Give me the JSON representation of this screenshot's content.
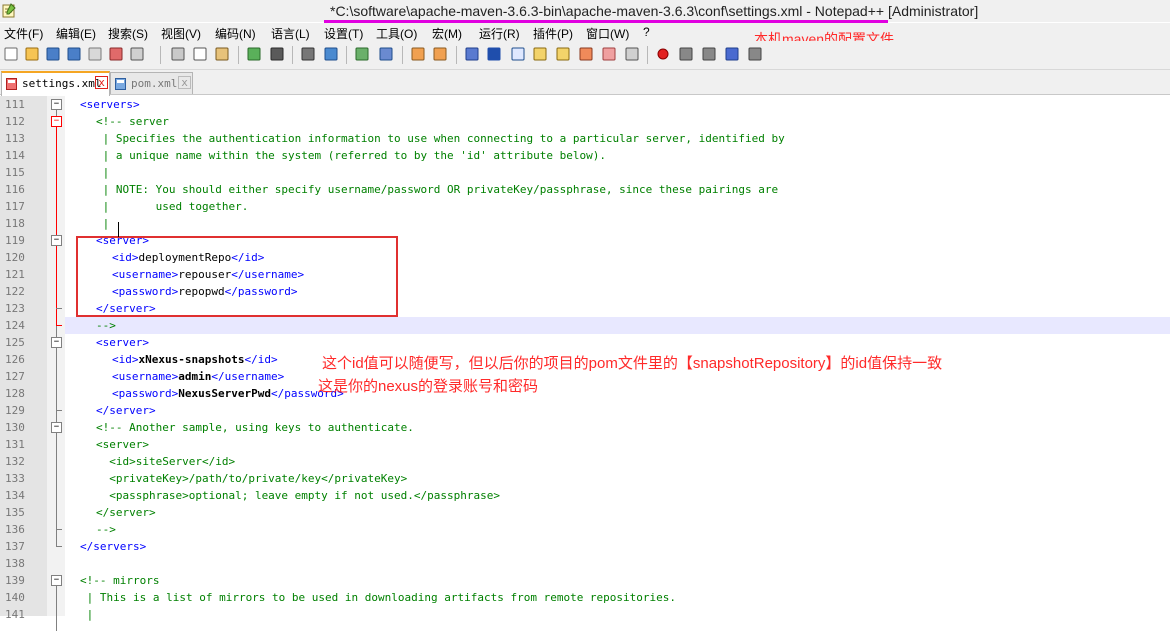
{
  "window": {
    "title": "*C:\\software\\apache-maven-3.6.3-bin\\apache-maven-3.6.3\\conf\\settings.xml - Notepad++ [Administrator]",
    "icon": "notepad-plus-plus-icon"
  },
  "menu": [
    "文件(F)",
    "编辑(E)",
    "搜索(S)",
    "视图(V)",
    "编码(N)",
    "语言(L)",
    "设置(T)",
    "工具(O)",
    "宏(M)",
    "运行(R)",
    "插件(P)",
    "窗口(W)",
    "?"
  ],
  "annotation_top": "本机maven的配置文件",
  "tabs": [
    {
      "label": "settings.xml",
      "active": true,
      "close": "x"
    },
    {
      "label": "pom.xml",
      "active": false,
      "close": "x"
    }
  ],
  "editor": {
    "current_line": 124,
    "lines": [
      {
        "n": "111",
        "parts": [
          [
            "t",
            "<servers>"
          ]
        ]
      },
      {
        "n": "112",
        "parts": [
          [
            "c",
            "<!-- server"
          ]
        ]
      },
      {
        "n": "113",
        "parts": [
          [
            "c",
            " | Specifies the authentication information to use when connecting to a particular server, identified by"
          ]
        ]
      },
      {
        "n": "114",
        "parts": [
          [
            "c",
            " | a unique name within the system (referred to by the 'id' attribute below)."
          ]
        ]
      },
      {
        "n": "115",
        "parts": [
          [
            "c",
            " |"
          ]
        ]
      },
      {
        "n": "116",
        "parts": [
          [
            "c",
            " | NOTE: You should either specify username/password OR privateKey/passphrase, since these pairings are"
          ]
        ]
      },
      {
        "n": "117",
        "parts": [
          [
            "c",
            " |       used together."
          ]
        ]
      },
      {
        "n": "118",
        "parts": [
          [
            "c",
            " |"
          ]
        ]
      },
      {
        "n": "119",
        "parts": [
          [
            "t",
            "<server>"
          ]
        ]
      },
      {
        "n": "120",
        "parts": [
          [
            "t",
            "<id>"
          ],
          [
            "x",
            "deploymentRepo"
          ],
          [
            "t",
            "</id>"
          ]
        ]
      },
      {
        "n": "121",
        "parts": [
          [
            "t",
            "<username>"
          ],
          [
            "x",
            "repouser"
          ],
          [
            "t",
            "</username>"
          ]
        ]
      },
      {
        "n": "122",
        "parts": [
          [
            "t",
            "<password>"
          ],
          [
            "x",
            "repopwd"
          ],
          [
            "t",
            "</password>"
          ]
        ]
      },
      {
        "n": "123",
        "parts": [
          [
            "t",
            "</server>"
          ]
        ]
      },
      {
        "n": "124",
        "parts": [
          [
            "c",
            "-->"
          ]
        ]
      },
      {
        "n": "125",
        "parts": [
          [
            "t",
            "<server>"
          ]
        ]
      },
      {
        "n": "126",
        "parts": [
          [
            "t",
            "<id>"
          ],
          [
            "b",
            "xNexus-snapshots"
          ],
          [
            "t",
            "</id>"
          ]
        ]
      },
      {
        "n": "127",
        "parts": [
          [
            "t",
            "<username>"
          ],
          [
            "b",
            "admin"
          ],
          [
            "t",
            "</username>"
          ]
        ]
      },
      {
        "n": "128",
        "parts": [
          [
            "t",
            "<password>"
          ],
          [
            "b",
            "NexusServerPwd"
          ],
          [
            "t",
            "</password>"
          ]
        ]
      },
      {
        "n": "129",
        "parts": [
          [
            "t",
            "</server>"
          ]
        ]
      },
      {
        "n": "130",
        "parts": [
          [
            "c",
            "<!-- Another sample, using keys to authenticate."
          ]
        ]
      },
      {
        "n": "131",
        "parts": [
          [
            "c",
            "<server>"
          ]
        ]
      },
      {
        "n": "132",
        "parts": [
          [
            "c",
            "  <id>siteServer</id>"
          ]
        ]
      },
      {
        "n": "133",
        "parts": [
          [
            "c",
            "  <privateKey>/path/to/private/key</privateKey>"
          ]
        ]
      },
      {
        "n": "134",
        "parts": [
          [
            "c",
            "  <passphrase>optional; leave empty if not used.</passphrase>"
          ]
        ]
      },
      {
        "n": "135",
        "parts": [
          [
            "c",
            "</server>"
          ]
        ]
      },
      {
        "n": "136",
        "parts": [
          [
            "c",
            "-->"
          ]
        ]
      },
      {
        "n": "137",
        "parts": [
          [
            "t",
            "</servers>"
          ]
        ]
      },
      {
        "n": "138",
        "parts": []
      },
      {
        "n": "139",
        "parts": [
          [
            "c",
            "<!-- mirrors"
          ]
        ]
      },
      {
        "n": "140",
        "parts": [
          [
            "c",
            " | This is a list of mirrors to be used in downloading artifacts from remote repositories."
          ]
        ]
      },
      {
        "n": "141",
        "parts": [
          [
            "c",
            " |"
          ]
        ]
      }
    ]
  },
  "annotations": {
    "id_note": "这个id值可以随便写，但以后你的项目的pom文件里的【snapshotRepository】的id值保持一致",
    "account_note": "这是你的nexus的登录账号和密码"
  },
  "colors": {
    "tag": "#0000ff",
    "comment": "#008000",
    "annotation": "#ff2a2a",
    "title_underline": "#e000e0",
    "highlight_box": "#e03030"
  }
}
